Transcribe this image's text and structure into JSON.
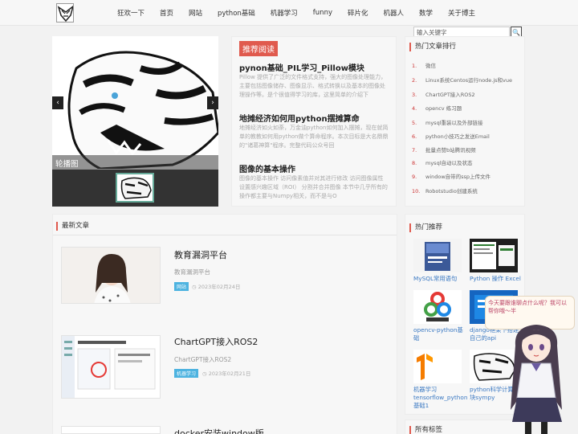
{
  "nav": {
    "items": [
      "狂欢一下",
      "首页",
      "网站",
      "python基础",
      "机器学习",
      "funny",
      "碎片化",
      "机器人",
      "数学",
      "关于博主"
    ]
  },
  "carousel": {
    "caption": "轮播图",
    "prev": "‹",
    "next": "›"
  },
  "recommend": {
    "tag": "推荐阅读",
    "items": [
      {
        "title": "pynon基础_PIL学习_Pillow模块",
        "desc": "Pillow 提供了广泛的文件格式支持，强大的图像处理能力，主要包括图像储存、图像显示、格式转换以及基本的图像处理操作等。是个很值得学习的库，这里简单的介绍下"
      },
      {
        "title": "地摊经济如何用python摆摊算命",
        "desc": "地摊经济如火如荼，万金油python如何加入摆摊，现在就简单的教教如何用python做个算命程序。本次目标是大名鼎鼎的\"诸葛神算\"程序。完整代码公众号回"
      },
      {
        "title": "图像的基本操作",
        "desc": "图像的基本操作 访问像素值并对其进行修改 访问图像属性 设置感兴趣区域（ROI） 分割并合并图像 本节中几乎所有的操作都主要与Numpy相关，而不是与O"
      }
    ]
  },
  "search": {
    "placeholder": "输入关键字",
    "button": "🔍"
  },
  "ranking": {
    "title": "热门文章排行",
    "items": [
      {
        "num": "1.",
        "text": "微信"
      },
      {
        "num": "2.",
        "text": "Linux系统Centos运行node.js和vue"
      },
      {
        "num": "3.",
        "text": "ChartGPT接入ROS2"
      },
      {
        "num": "4.",
        "text": "opencv 练习题"
      },
      {
        "num": "5.",
        "text": "mysql重装以及外部链接"
      },
      {
        "num": "6.",
        "text": "python小技巧之发送Email"
      },
      {
        "num": "7.",
        "text": "批量点赞b站腾讯视频"
      },
      {
        "num": "8.",
        "text": "mysql自动以及状态"
      },
      {
        "num": "9.",
        "text": "window自带的ssp上传文件"
      },
      {
        "num": "10.",
        "text": "Robotstudio创建系统"
      }
    ]
  },
  "hot": {
    "title": "热门推荐",
    "items": [
      {
        "label": "MySQL常用语句"
      },
      {
        "label": "Python 操作 Excel"
      },
      {
        "label": "opencv-python基础"
      },
      {
        "label": "django框架下搭建自己的api"
      },
      {
        "label": "机器学习tensorflow_python基础1"
      },
      {
        "label": "python科学计算模块sympy"
      }
    ]
  },
  "tags_title": "所有标签",
  "news": {
    "title": "最新文章",
    "items": [
      {
        "title": "教育漏洞平台",
        "excerpt": "教育漏洞平台",
        "tag": "网站",
        "date": "2023年02月24日"
      },
      {
        "title": "ChartGPT接入ROS2",
        "excerpt": "ChartGPT接入ROS2",
        "tag": "机器学习",
        "date": "2023年02月21日"
      },
      {
        "title": "docker安装window版",
        "excerpt": "",
        "tag": "",
        "date": ""
      }
    ]
  },
  "mascot": {
    "bubble": "今天要跟谁聊点什么呢？我可以帮你哦～半"
  }
}
